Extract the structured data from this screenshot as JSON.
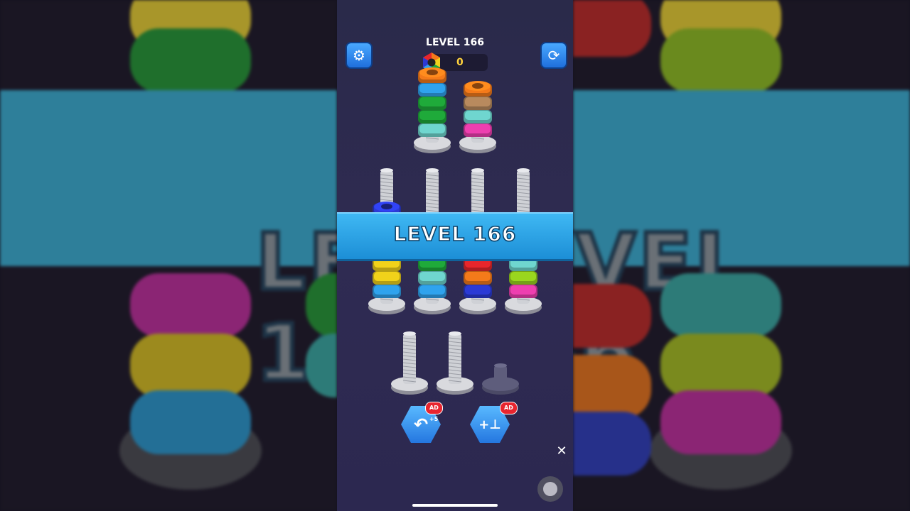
{
  "level": {
    "title": "LEVEL 166",
    "banner_text": "LEVEL 166",
    "background_text": "LEVEL 166"
  },
  "score": {
    "value": "0",
    "icon": "rainbow-hex-nut-icon"
  },
  "header": {
    "settings_icon": "gear-icon",
    "restart_icon": "refresh-icon"
  },
  "colors": {
    "orange": "#f47a1a",
    "blue": "#2fa3ee",
    "navy": "#2b3ad6",
    "green": "#1faa3a",
    "teal": "#6fd6cf",
    "tan": "#b88a5e",
    "pink": "#ee3fb0",
    "yellow": "#f1d21a",
    "red": "#e8262c",
    "lime": "#9ad61e",
    "banner": "#2aa4e8"
  },
  "board": {
    "rows": [
      {
        "pegs": [
          {
            "nuts_bottom_to_top": [
              "teal",
              "green",
              "green",
              "blue",
              "orange"
            ]
          },
          {
            "nuts_bottom_to_top": [
              "pink",
              "teal",
              "tan",
              "orange"
            ]
          }
        ]
      },
      {
        "pegs": [
          {
            "nuts_bottom_to_top": [
              "blue",
              "yellow",
              "yellow",
              "pink",
              "green",
              "yellow",
              "navy"
            ]
          },
          {
            "nuts_bottom_to_top": [
              "blue",
              "teal",
              "green",
              "yellow",
              "green",
              "navy"
            ]
          },
          {
            "nuts_bottom_to_top": [
              "navy",
              "orange",
              "red",
              "orange",
              "red",
              "navy"
            ]
          },
          {
            "nuts_bottom_to_top": [
              "pink",
              "lime",
              "teal",
              "lime",
              "yellow",
              "tan"
            ]
          }
        ]
      },
      {
        "pegs": [
          {
            "nuts_bottom_to_top": [],
            "locked": false
          },
          {
            "nuts_bottom_to_top": [],
            "locked": false
          },
          {
            "nuts_bottom_to_top": [],
            "locked": true
          }
        ]
      }
    ]
  },
  "tools": {
    "undo": {
      "icon": "undo-icon",
      "badge": "AD +5"
    },
    "add_peg": {
      "icon": "add-bolt-icon",
      "badge": "AD"
    }
  },
  "overlay": {
    "close_icon": "close-icon",
    "close_glyph": "✕"
  }
}
